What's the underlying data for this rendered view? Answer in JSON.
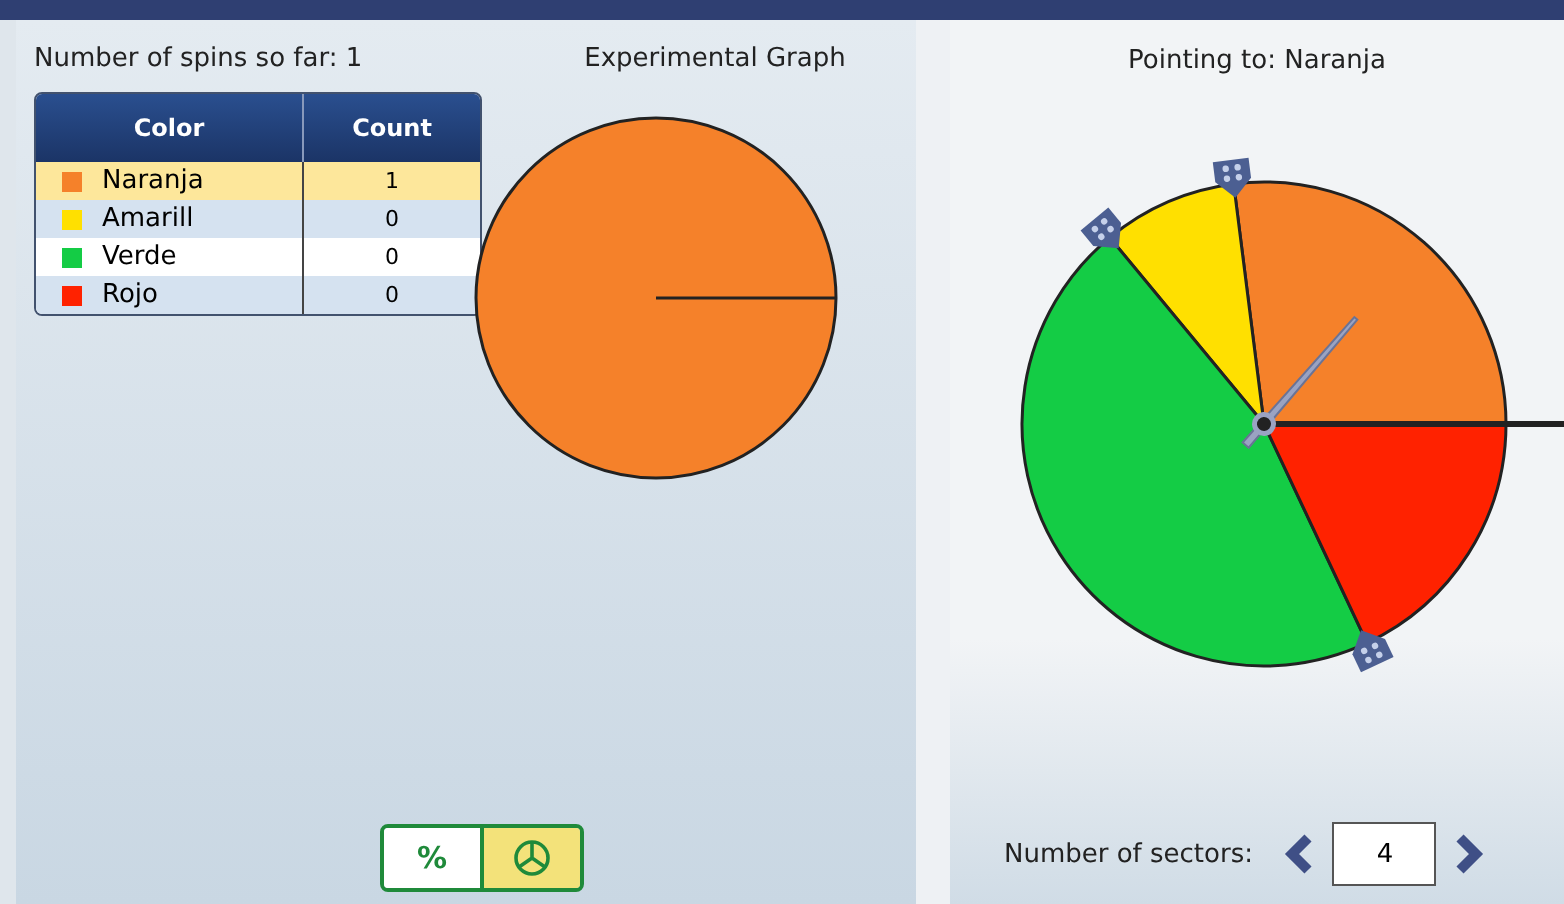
{
  "counts": {
    "spins_label": "Number of spins so far: 1",
    "columns": [
      "Color",
      "Count"
    ],
    "rows": [
      {
        "name": "Naranja",
        "count": "1",
        "color": "#f5812a",
        "selected": true
      },
      {
        "name": "Amarill",
        "count": "0",
        "color": "#ffe000",
        "selected": false
      },
      {
        "name": "Verde",
        "count": "0",
        "color": "#14cc45",
        "selected": false
      },
      {
        "name": "Rojo",
        "count": "0",
        "color": "#ff2200",
        "selected": false
      }
    ]
  },
  "graph": {
    "title": "Experimental Graph"
  },
  "view_toggle": [
    {
      "kind": "percent",
      "label": "%",
      "selected": false
    },
    {
      "kind": "pie",
      "selected": true
    }
  ],
  "spinner": {
    "title": "Pointing to: Naranja"
  },
  "sectors_control": {
    "label": "Number of sectors:",
    "value": "4"
  }
}
